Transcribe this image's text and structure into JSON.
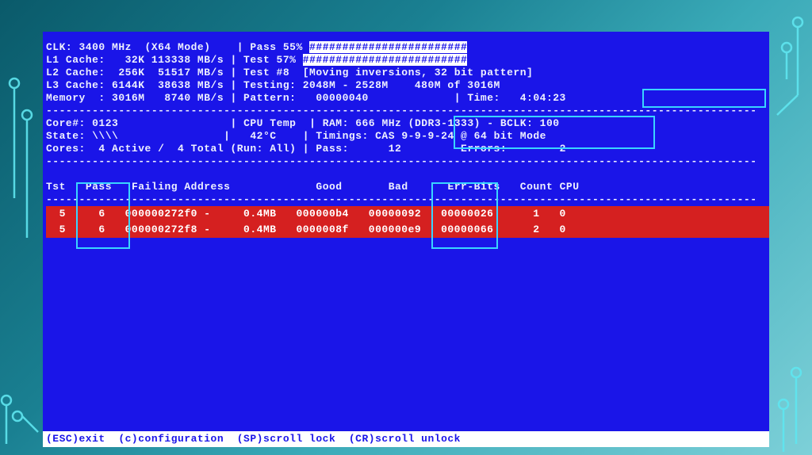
{
  "sysinfo": {
    "clk": "CLK: 3400 MHz  (X64 Mode)",
    "l1": "L1 Cache:   32K 113338 MB/s",
    "l2": "L2 Cache:  256K  51517 MB/s",
    "l3": "L3 Cache: 6144K  38638 MB/s",
    "mem": "Memory  : 3016M   8740 MB/s"
  },
  "testinfo": {
    "pass": "Pass 55%",
    "test": "Test 57%",
    "testnum": "Test #8  [Moving inversions, 32 bit pattern]",
    "testing": "Testing: 2048M - 2528M    480M of 3016M",
    "pattern": "Pattern:   00000040",
    "time_label": "Time:",
    "time": "4:04:23"
  },
  "cpuinfo": {
    "core": "Core#: 0123",
    "state": "State: \\\\\\\\",
    "cores": "Cores:  4 Active /  4 Total",
    "temp_label": "CPU Temp",
    "temp": "42°C",
    "run": "(Run: All)"
  },
  "raminfo": {
    "ram": "RAM: 666",
    "mhz": "MHz (DDR3-1333) -",
    "bclk": "BCLK: 100",
    "timings_label": "Timings:",
    "timings": "CAS 9-9-9-24 @ 64",
    "bitmode": "bit Mode",
    "pass_label": "Pass:",
    "pass_value": "12",
    "errors_label": "Errors:",
    "errors_value": "2"
  },
  "columns": {
    "tst": "Tst",
    "pass": "Pass",
    "addr": "Failing Address",
    "good": "Good",
    "bad": "Bad",
    "errbits": "Err-Bits",
    "count": "Count",
    "cpu": "CPU"
  },
  "errors": [
    {
      "tst": "5",
      "pass": "6",
      "addr": "000000272f0 -     0.4MB",
      "good": "000000b4",
      "bad": "00000092",
      "errbits": "00000026",
      "count": "1",
      "cpu": "0"
    },
    {
      "tst": "5",
      "pass": "6",
      "addr": "000000272f8 -     0.4MB",
      "good": "0000008f",
      "bad": "000000e9",
      "errbits": "00000066",
      "count": "2",
      "cpu": "0"
    }
  ],
  "footer": {
    "text": "(ESC)exit  (c)configuration  (SP)scroll lock  (CR)scroll unlock"
  }
}
